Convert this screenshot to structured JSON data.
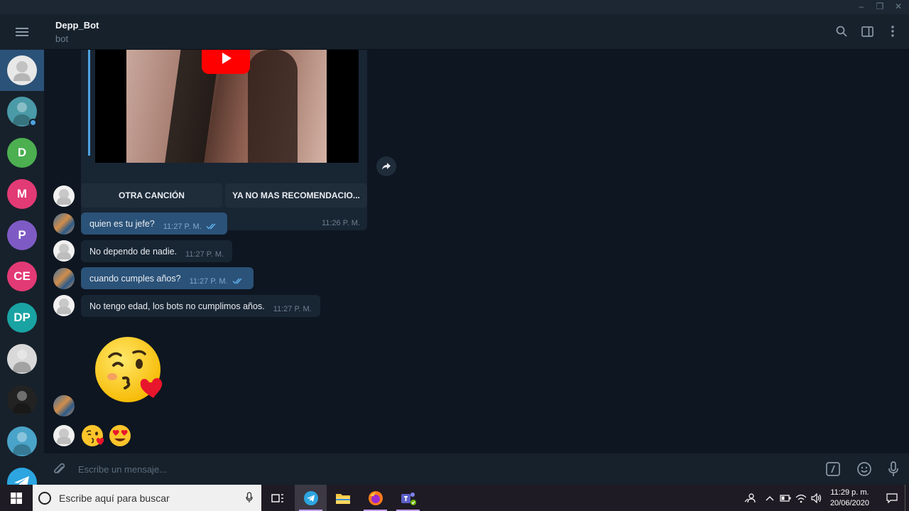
{
  "window": {
    "minimize": "–",
    "restore": "❐",
    "close": "✕"
  },
  "header": {
    "title": "Depp_Bot",
    "subtitle": "bot"
  },
  "sidebar": {
    "chats": [
      {
        "initials": "",
        "color": "#e8e8e8",
        "kind": "bot-avatar"
      },
      {
        "initials": "",
        "color": "#4a9aa8",
        "kind": "photo",
        "online": true
      },
      {
        "initials": "D",
        "color": "#4caf50"
      },
      {
        "initials": "M",
        "color": "#e23a75"
      },
      {
        "initials": "P",
        "color": "#7e5bc4"
      },
      {
        "initials": "CE",
        "color": "#e23a75"
      },
      {
        "initials": "DP",
        "color": "#1aa3a3"
      },
      {
        "initials": "",
        "color": "#d9d9d9",
        "kind": "photo"
      },
      {
        "initials": "",
        "color": "#222222",
        "kind": "photo"
      },
      {
        "initials": "",
        "color": "#4aa3c8",
        "kind": "photo"
      },
      {
        "initials": "",
        "color": "#2ca5e0",
        "kind": "telegram"
      }
    ]
  },
  "media_message": {
    "time": "11:26 P. M."
  },
  "keyboard": {
    "buttons": [
      "OTRA CANCIÓN",
      "YA NO MAS RECOMENDACIO..."
    ]
  },
  "messages": [
    {
      "side": "out",
      "text": "quien es tu jefe?",
      "time": "11:27 P. M.",
      "read": true
    },
    {
      "side": "in",
      "text": "No dependo de nadie.",
      "time": "11:27 P. M."
    },
    {
      "side": "out",
      "text": "cuando cumples años?",
      "time": "11:27 P. M.",
      "read": true
    },
    {
      "side": "in",
      "text": "No tengo edad, los bots no cumplimos años.",
      "time": "11:27 P. M."
    }
  ],
  "stickers": {
    "big": "face-blowing-a-kiss",
    "small": [
      "face-blowing-a-kiss",
      "smiling-face-with-heart-eyes"
    ]
  },
  "composer": {
    "placeholder": "Escribe un mensaje..."
  },
  "taskbar": {
    "search_placeholder": "Escribe aquí para buscar",
    "clock_time": "11:29 p. m.",
    "clock_date": "20/06/2020"
  },
  "colors": {
    "accent": "#2b5278",
    "link": "#4fa3e0",
    "background": "#0e1621",
    "panel": "#17212b"
  }
}
